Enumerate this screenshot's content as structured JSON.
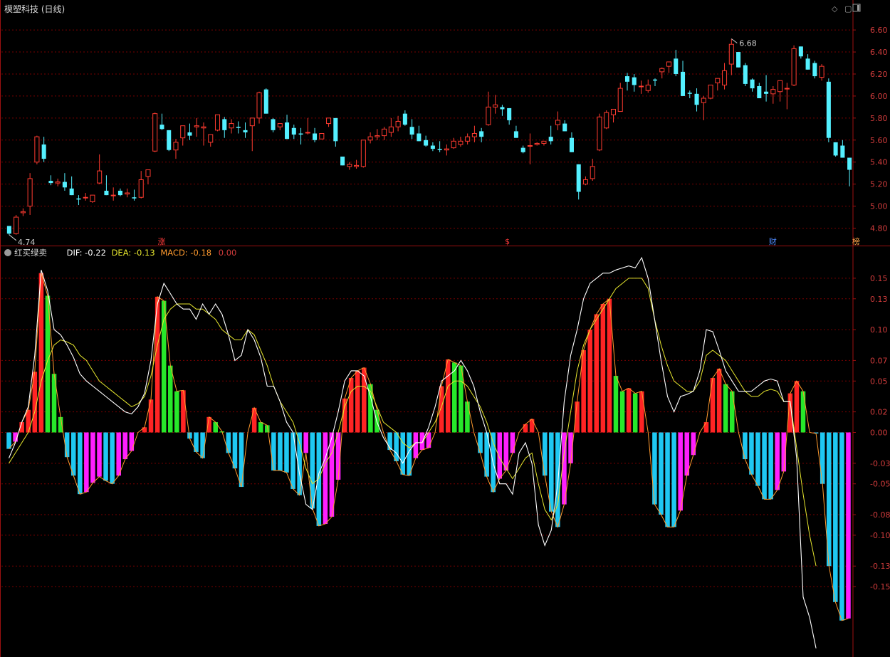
{
  "price_panel": {
    "title": "模塑科技 (日线)",
    "high_label": "6.68",
    "low_label": "4.74",
    "markers": [
      {
        "label": "涨",
        "color": "#ff3b3b"
      },
      {
        "label": "$",
        "color": "#ff3b3b"
      },
      {
        "label": "财",
        "color": "#4f8bff"
      },
      {
        "label": "榜",
        "color": "#ffa54a"
      }
    ]
  },
  "indicator_panel": {
    "title": "红买绿卖",
    "dif_label": "DIF:",
    "dif_value": "-0.22",
    "dea_label": "DEA:",
    "dea_value": "-0.13",
    "macd_label": "MACD:",
    "macd_value": "-0.18",
    "extra_value": "0.00"
  },
  "colors": {
    "up": "#ff3b30",
    "down": "#54f0ff",
    "grid": "#7a0000",
    "axis": "#9b1010",
    "axis_text": "#d23c3c",
    "dif": "#ffffff",
    "dea": "#e6e62e",
    "macd_line": "#ff9a2e",
    "bar_red": "#ff2424",
    "bar_green": "#27e82a",
    "bar_cyan": "#1fc8f2",
    "bar_magenta": "#ff1fff"
  },
  "chart_data": [
    {
      "type": "candlestick",
      "title": "模塑科技 (日线)",
      "y_ticks": [
        "6.60",
        "6.40",
        "6.20",
        "6.00",
        "5.80",
        "5.60",
        "5.40",
        "5.20",
        "5.00",
        "4.80"
      ],
      "ylim": [
        4.7,
        6.73
      ],
      "annotations": [
        {
          "text": "6.68",
          "type": "high"
        },
        {
          "text": "4.74",
          "type": "low"
        }
      ],
      "ohlc": [
        [
          4.82,
          4.82,
          4.74,
          4.75
        ],
        [
          4.75,
          4.92,
          4.74,
          4.9
        ],
        [
          4.94,
          4.98,
          4.91,
          4.95
        ],
        [
          5.0,
          5.3,
          4.92,
          5.25
        ],
        [
          5.4,
          5.64,
          5.38,
          5.63
        ],
        [
          5.56,
          5.63,
          5.4,
          5.43
        ],
        [
          5.23,
          5.28,
          5.19,
          5.21
        ],
        [
          5.21,
          5.25,
          5.18,
          5.22
        ],
        [
          5.22,
          5.3,
          5.14,
          5.17
        ],
        [
          5.16,
          5.27,
          5.1,
          5.1
        ],
        [
          5.07,
          5.1,
          5.01,
          5.06
        ],
        [
          5.08,
          5.12,
          5.05,
          5.08
        ],
        [
          5.04,
          5.1,
          5.03,
          5.1
        ],
        [
          5.21,
          5.47,
          5.2,
          5.32
        ],
        [
          5.14,
          5.28,
          5.1,
          5.1
        ],
        [
          5.1,
          5.17,
          5.05,
          5.1
        ],
        [
          5.14,
          5.16,
          5.09,
          5.1
        ],
        [
          5.11,
          5.16,
          5.08,
          5.12
        ],
        [
          5.08,
          5.15,
          5.05,
          5.07
        ],
        [
          5.08,
          5.32,
          5.07,
          5.24
        ],
        [
          5.27,
          5.32,
          5.2,
          5.33
        ],
        [
          5.5,
          5.85,
          5.49,
          5.84
        ],
        [
          5.74,
          5.84,
          5.69,
          5.7
        ],
        [
          5.69,
          5.69,
          5.5,
          5.51
        ],
        [
          5.51,
          5.61,
          5.43,
          5.58
        ],
        [
          5.62,
          5.71,
          5.55,
          5.73
        ],
        [
          5.67,
          5.75,
          5.6,
          5.64
        ],
        [
          5.72,
          5.8,
          5.63,
          5.73
        ],
        [
          5.71,
          5.76,
          5.55,
          5.72
        ],
        [
          5.58,
          5.65,
          5.54,
          5.65
        ],
        [
          5.69,
          5.82,
          5.68,
          5.83
        ],
        [
          5.79,
          5.81,
          5.62,
          5.69
        ],
        [
          5.71,
          5.79,
          5.66,
          5.75
        ],
        [
          5.72,
          5.77,
          5.66,
          5.71
        ],
        [
          5.69,
          5.76,
          5.62,
          5.67
        ],
        [
          5.73,
          5.79,
          5.5,
          5.8
        ],
        [
          5.8,
          6.04,
          5.75,
          6.03
        ],
        [
          6.06,
          6.07,
          5.84,
          5.84
        ],
        [
          5.79,
          5.8,
          5.67,
          5.69
        ],
        [
          5.72,
          5.74,
          5.69,
          5.75
        ],
        [
          5.76,
          5.83,
          5.62,
          5.61
        ],
        [
          5.71,
          5.74,
          5.61,
          5.65
        ],
        [
          5.66,
          5.71,
          5.56,
          5.65
        ],
        [
          5.67,
          5.8,
          5.65,
          5.67
        ],
        [
          5.66,
          5.71,
          5.58,
          5.6
        ],
        [
          5.61,
          5.63,
          5.61,
          5.66
        ],
        [
          5.75,
          5.8,
          5.72,
          5.8
        ],
        [
          5.8,
          5.8,
          5.54,
          5.59
        ],
        [
          5.45,
          5.45,
          5.37,
          5.37
        ],
        [
          5.36,
          5.4,
          5.33,
          5.38
        ],
        [
          5.36,
          5.42,
          5.34,
          5.37
        ],
        [
          5.36,
          5.6,
          5.35,
          5.6
        ],
        [
          5.6,
          5.67,
          5.57,
          5.63
        ],
        [
          5.63,
          5.7,
          5.6,
          5.64
        ],
        [
          5.64,
          5.72,
          5.6,
          5.7
        ],
        [
          5.67,
          5.8,
          5.63,
          5.72
        ],
        [
          5.72,
          5.82,
          5.68,
          5.77
        ],
        [
          5.84,
          5.87,
          5.73,
          5.74
        ],
        [
          5.72,
          5.79,
          5.61,
          5.65
        ],
        [
          5.66,
          5.73,
          5.6,
          5.59
        ],
        [
          5.6,
          5.64,
          5.54,
          5.55
        ],
        [
          5.55,
          5.58,
          5.5,
          5.52
        ],
        [
          5.52,
          5.59,
          5.49,
          5.51
        ],
        [
          5.51,
          5.56,
          5.46,
          5.52
        ],
        [
          5.53,
          5.62,
          5.52,
          5.59
        ],
        [
          5.56,
          5.63,
          5.54,
          5.59
        ],
        [
          5.59,
          5.66,
          5.56,
          5.63
        ],
        [
          5.63,
          5.73,
          5.58,
          5.66
        ],
        [
          5.68,
          5.71,
          5.58,
          5.63
        ],
        [
          5.74,
          6.04,
          5.73,
          5.9
        ],
        [
          5.9,
          6.01,
          5.84,
          5.92
        ],
        [
          5.9,
          5.92,
          5.82,
          5.88
        ],
        [
          5.89,
          5.89,
          5.74,
          5.78
        ],
        [
          5.68,
          5.73,
          5.65,
          5.62
        ],
        [
          5.53,
          5.55,
          5.48,
          5.49
        ],
        [
          5.55,
          5.66,
          5.38,
          5.55
        ],
        [
          5.56,
          5.58,
          5.55,
          5.57
        ],
        [
          5.57,
          5.59,
          5.55,
          5.59
        ],
        [
          5.63,
          5.73,
          5.56,
          5.59
        ],
        [
          5.74,
          5.86,
          5.69,
          5.78
        ],
        [
          5.75,
          5.78,
          5.69,
          5.68
        ],
        [
          5.62,
          5.67,
          5.51,
          5.49
        ],
        [
          5.38,
          5.38,
          5.06,
          5.13
        ],
        [
          5.2,
          5.27,
          5.19,
          5.24
        ],
        [
          5.25,
          5.43,
          5.23,
          5.36
        ],
        [
          5.51,
          5.84,
          5.5,
          5.81
        ],
        [
          5.71,
          5.87,
          5.7,
          5.85
        ],
        [
          5.83,
          5.87,
          5.76,
          5.88
        ],
        [
          5.86,
          6.12,
          5.86,
          6.07
        ],
        [
          6.18,
          6.21,
          6.05,
          6.13
        ],
        [
          6.17,
          6.2,
          6.04,
          6.1
        ],
        [
          6.09,
          6.14,
          6.02,
          6.09
        ],
        [
          6.05,
          6.15,
          6.03,
          6.1
        ],
        [
          6.15,
          6.16,
          6.09,
          6.14
        ],
        [
          6.22,
          6.26,
          6.16,
          6.25
        ],
        [
          6.27,
          6.28,
          6.21,
          6.31
        ],
        [
          6.34,
          6.42,
          6.18,
          6.2
        ],
        [
          6.22,
          6.32,
          6.02,
          6.0
        ],
        [
          6.03,
          6.05,
          5.98,
          6.02
        ],
        [
          6.02,
          6.07,
          5.86,
          5.92
        ],
        [
          5.94,
          6.0,
          5.78,
          5.98
        ],
        [
          5.98,
          6.07,
          5.97,
          6.1
        ],
        [
          6.12,
          6.12,
          6.05,
          6.16
        ],
        [
          6.1,
          6.3,
          6.06,
          6.23
        ],
        [
          6.29,
          6.52,
          6.19,
          6.47
        ],
        [
          6.4,
          6.28,
          6.26,
          6.26
        ],
        [
          6.28,
          6.3,
          6.09,
          6.11
        ],
        [
          6.15,
          6.16,
          6.04,
          6.07
        ],
        [
          6.09,
          6.12,
          5.98,
          5.98
        ],
        [
          6.04,
          6.19,
          5.95,
          6.02
        ],
        [
          6.02,
          6.09,
          5.93,
          6.06
        ],
        [
          6.04,
          6.09,
          5.95,
          6.14
        ],
        [
          6.07,
          6.12,
          5.88,
          6.07
        ],
        [
          6.1,
          6.46,
          6.09,
          6.43
        ],
        [
          6.45,
          6.45,
          6.34,
          6.36
        ],
        [
          6.34,
          6.38,
          6.26,
          6.24
        ],
        [
          6.3,
          6.32,
          6.16,
          6.18
        ],
        [
          6.17,
          6.29,
          6.14,
          6.27
        ],
        [
          6.13,
          6.16,
          5.58,
          5.62
        ],
        [
          5.58,
          5.56,
          5.45,
          5.46
        ],
        [
          5.55,
          5.6,
          5.46,
          5.44
        ],
        [
          5.44,
          5.43,
          5.18,
          5.33
        ]
      ]
    },
    {
      "type": "bar",
      "title": "红买绿卖",
      "y_ticks": [
        "0.15",
        "0.13",
        "0.10",
        "0.07",
        "0.05",
        "0.02",
        "0.00",
        "-0.03",
        "-0.05",
        "-0.08",
        "-0.10",
        "-0.13",
        "-0.15"
      ],
      "ylim": [
        -0.215,
        0.17
      ],
      "series": [
        {
          "name": "DIF",
          "values": [
            -0.025,
            -0.01,
            0.01,
            0.025,
            0.075,
            0.158,
            0.138,
            0.1,
            0.095,
            0.085,
            0.073,
            0.057,
            0.05,
            0.045,
            0.04,
            0.035,
            0.03,
            0.025,
            0.02,
            0.018,
            0.025,
            0.038,
            0.07,
            0.125,
            0.145,
            0.135,
            0.125,
            0.12,
            0.12,
            0.11,
            0.125,
            0.115,
            0.125,
            0.115,
            0.095,
            0.07,
            0.075,
            0.1,
            0.09,
            0.073,
            0.045,
            0.045,
            0.03,
            0.01,
            0.0,
            -0.04,
            -0.07,
            -0.075,
            -0.04,
            -0.025,
            -0.005,
            0.02,
            0.05,
            0.06,
            0.06,
            0.055,
            0.035,
            0.01,
            -0.005,
            -0.015,
            -0.02,
            -0.03,
            -0.018,
            -0.01,
            -0.01,
            0.005,
            0.025,
            0.05,
            0.055,
            0.06,
            0.07,
            0.06,
            0.045,
            0.02,
            0.0,
            -0.03,
            -0.05,
            -0.05,
            -0.06,
            -0.02,
            -0.01,
            -0.03,
            -0.09,
            -0.11,
            -0.095,
            -0.05,
            0.03,
            0.075,
            0.1,
            0.13,
            0.145,
            0.15,
            0.155,
            0.155,
            0.158,
            0.16,
            0.162,
            0.16,
            0.17,
            0.15,
            0.11,
            0.07,
            0.035,
            0.02,
            0.035,
            0.037,
            0.04,
            0.06,
            0.1,
            0.098,
            0.08,
            0.06,
            0.05,
            0.04,
            0.04,
            0.04,
            0.045,
            0.05,
            0.052,
            0.05,
            0.03,
            0.03,
            -0.025,
            -0.16,
            -0.18,
            -0.21
          ]
        },
        {
          "name": "DEA",
          "values": [
            -0.03,
            -0.02,
            -0.01,
            0.0,
            0.02,
            0.05,
            0.07,
            0.085,
            0.09,
            0.088,
            0.085,
            0.075,
            0.07,
            0.06,
            0.05,
            0.045,
            0.04,
            0.035,
            0.03,
            0.025,
            0.028,
            0.035,
            0.055,
            0.085,
            0.11,
            0.12,
            0.125,
            0.125,
            0.125,
            0.12,
            0.12,
            0.115,
            0.11,
            0.1,
            0.095,
            0.09,
            0.09,
            0.1,
            0.095,
            0.08,
            0.065,
            0.045,
            0.03,
            0.02,
            0.01,
            -0.01,
            -0.035,
            -0.05,
            -0.045,
            -0.03,
            -0.02,
            0.0,
            0.025,
            0.04,
            0.045,
            0.045,
            0.04,
            0.025,
            0.01,
            0.005,
            0.0,
            -0.01,
            -0.015,
            -0.01,
            -0.01,
            0.0,
            0.01,
            0.025,
            0.045,
            0.05,
            0.05,
            0.045,
            0.035,
            0.025,
            0.01,
            -0.01,
            -0.025,
            -0.035,
            -0.045,
            -0.035,
            -0.025,
            -0.02,
            -0.05,
            -0.075,
            -0.085,
            -0.07,
            -0.02,
            0.02,
            0.06,
            0.085,
            0.1,
            0.11,
            0.12,
            0.13,
            0.14,
            0.145,
            0.15,
            0.15,
            0.15,
            0.14,
            0.11,
            0.085,
            0.065,
            0.05,
            0.045,
            0.04,
            0.04,
            0.05,
            0.075,
            0.08,
            0.075,
            0.07,
            0.06,
            0.05,
            0.04,
            0.035,
            0.035,
            0.04,
            0.042,
            0.04,
            0.03,
            0.03,
            -0.015,
            -0.06,
            -0.1,
            -0.13
          ]
        },
        {
          "name": "MACD",
          "values": [
            -0.016,
            -0.009,
            0.01,
            0.022,
            0.059,
            0.155,
            0.133,
            0.057,
            0.015,
            -0.024,
            -0.042,
            -0.06,
            -0.058,
            -0.049,
            -0.043,
            -0.047,
            -0.05,
            -0.042,
            -0.026,
            -0.018,
            0.0,
            0.005,
            0.032,
            0.132,
            0.128,
            0.065,
            0.04,
            0.041,
            -0.006,
            -0.019,
            -0.025,
            0.015,
            0.01,
            0.001,
            -0.02,
            -0.035,
            -0.053,
            0.0,
            0.024,
            0.01,
            0.007,
            -0.037,
            -0.037,
            -0.039,
            -0.055,
            -0.061,
            -0.02,
            -0.074,
            -0.091,
            -0.089,
            -0.082,
            -0.046,
            0.033,
            0.053,
            0.06,
            0.063,
            0.047,
            0.022,
            0.0,
            -0.017,
            -0.028,
            -0.041,
            -0.042,
            -0.025,
            -0.017,
            -0.015,
            0.0,
            0.045,
            0.071,
            0.068,
            0.065,
            0.03,
            0.0,
            -0.02,
            -0.043,
            -0.058,
            -0.045,
            -0.037,
            -0.02,
            0.0,
            0.008,
            0.013,
            0.0,
            -0.042,
            -0.077,
            -0.092,
            -0.07,
            -0.03,
            0.03,
            0.08,
            0.1,
            0.115,
            0.125,
            0.13,
            0.055,
            0.04,
            0.043,
            0.038,
            0.04,
            0.0,
            -0.07,
            -0.08,
            -0.092,
            -0.092,
            -0.076,
            -0.042,
            -0.022,
            0.0,
            0.01,
            0.053,
            0.062,
            0.047,
            0.04,
            0.0,
            -0.026,
            -0.041,
            -0.052,
            -0.065,
            -0.065,
            -0.056,
            -0.038,
            0.038,
            0.05,
            0.04,
            0.0,
            -0.001,
            -0.05,
            -0.13,
            -0.165,
            -0.183,
            -0.181
          ]
        }
      ]
    }
  ]
}
